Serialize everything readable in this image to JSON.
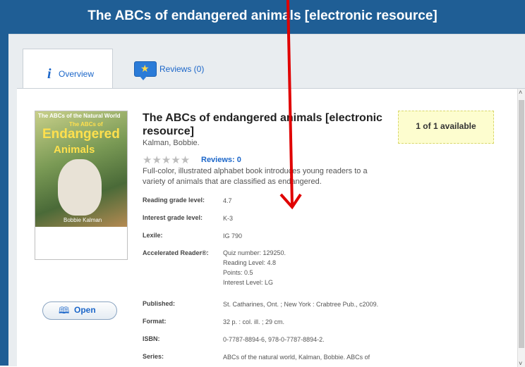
{
  "header": {
    "title": "The ABCs of endangered animals [electronic resource]"
  },
  "tabs": [
    {
      "label": "Overview",
      "icon": "info-icon"
    },
    {
      "label": "Reviews (0)",
      "icon": "review-bubble-icon"
    }
  ],
  "cover": {
    "series_line": "The ABCs of the Natural World",
    "the": "The ABCs of",
    "line1": "Endangered",
    "line2": "Animals",
    "author": "Bobbie Kalman"
  },
  "open_button": {
    "label": "Open"
  },
  "title": "The ABCs of endangered animals [electronic resource]",
  "author": "Kalman, Bobbie.",
  "rating": {
    "stars": "★★★★★",
    "reviews_label": "Reviews: 0"
  },
  "summary": "Full-color, illustrated alphabet book introduces young readers to a variety of animals that are classified as endangered.",
  "availability": "1 of 1 available",
  "details": {
    "reading_grade": {
      "label": "Reading grade level:",
      "value": "4.7"
    },
    "interest_grade": {
      "label": "Interest grade level:",
      "value": "K-3"
    },
    "lexile": {
      "label": "Lexile:",
      "value": "IG 790"
    },
    "ar": {
      "label": "Accelerated Reader®:",
      "values": [
        "Quiz number: 129250.",
        "Reading Level: 4.8",
        "Points: 0.5",
        "Interest Level: LG"
      ]
    },
    "published": {
      "label": "Published:",
      "value": "St. Catharines, Ont. ; New York : Crabtree Pub., c2009."
    },
    "format": {
      "label": "Format:",
      "value": "32 p. : col. ill. ; 29 cm."
    },
    "isbn": {
      "label": "ISBN:",
      "value": "0-7787-8894-6, 978-0-7787-8894-2."
    },
    "series": {
      "label": "Series:",
      "value": "ABCs of the natural world, Kalman, Bobbie. ABCs of"
    }
  },
  "colors": {
    "header": "#1f5e95",
    "link": "#1b66c9",
    "arrow": "#e00000"
  }
}
